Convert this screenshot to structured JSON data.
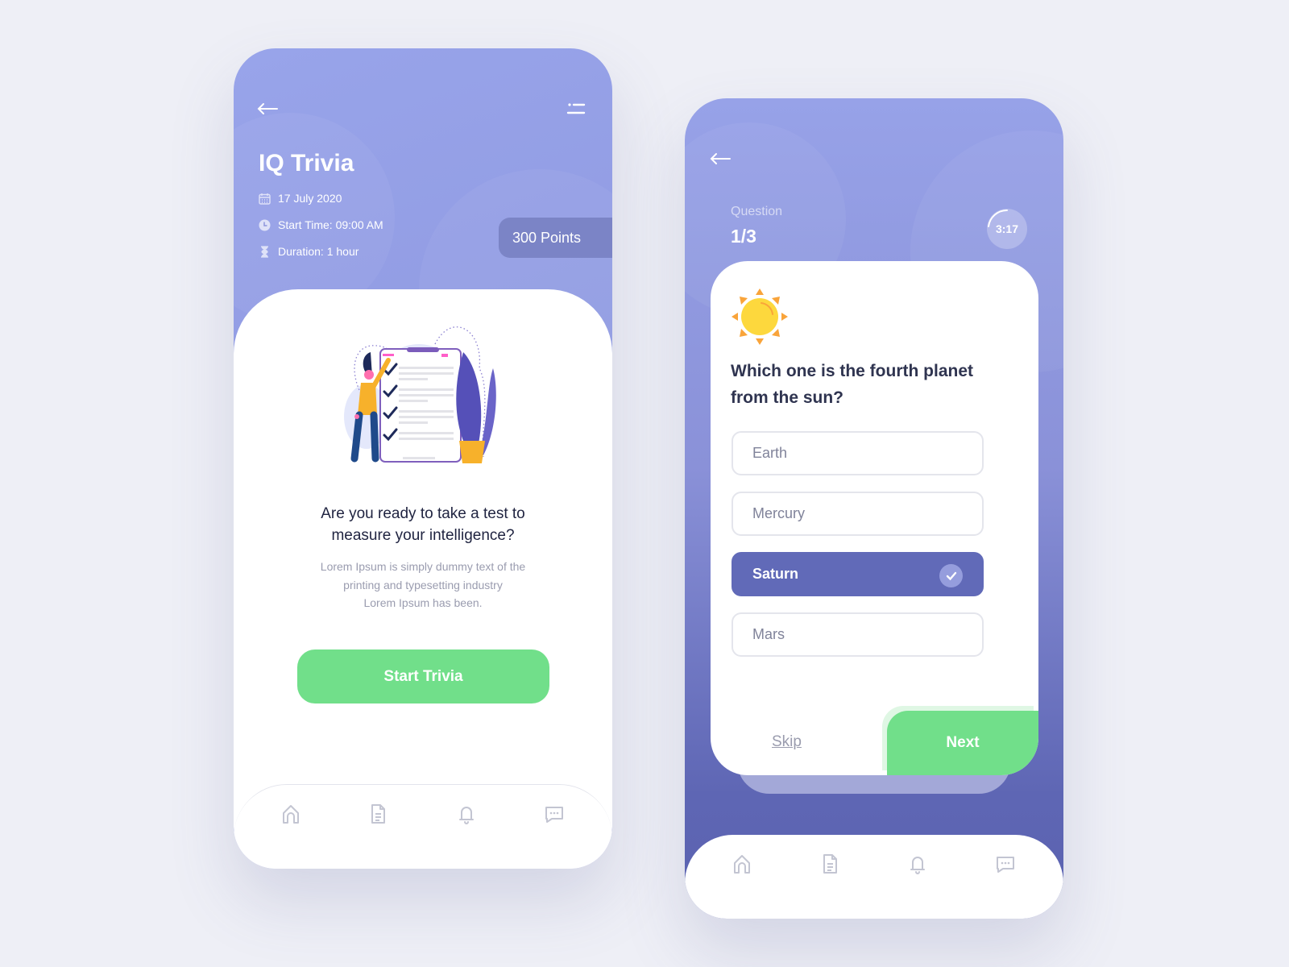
{
  "colors": {
    "accent": "#616ab8",
    "green": "#71df8a",
    "header": "#939eea",
    "background": "#eeeff6"
  },
  "left": {
    "title": "IQ Trivia",
    "date": "17 July 2020",
    "start_time": "Start Time: 09:00 AM",
    "duration": "Duration: 1 hour",
    "points": "300 Points",
    "heading_line1": "Are you ready to take a test to",
    "heading_line2": "measure your intelligence?",
    "desc_line1": "Lorem Ipsum is simply dummy text of the",
    "desc_line2": "printing and typesetting industry",
    "desc_line3": "Lorem Ipsum has been.",
    "start_button": "Start Trivia",
    "nav": [
      "home-icon",
      "document-icon",
      "bell-icon",
      "chat-icon"
    ]
  },
  "right": {
    "question_label": "Question",
    "question_progress": "1/3",
    "timer": "3:17",
    "question_line1": "Which one is the fourth planet",
    "question_line2": "from the sun?",
    "options": [
      {
        "label": "Earth",
        "selected": false
      },
      {
        "label": "Mercury",
        "selected": false
      },
      {
        "label": "Saturn",
        "selected": true
      },
      {
        "label": "Mars",
        "selected": false
      }
    ],
    "skip": "Skip",
    "next": "Next",
    "nav": [
      "home-icon",
      "document-icon",
      "bell-icon",
      "chat-icon"
    ]
  }
}
